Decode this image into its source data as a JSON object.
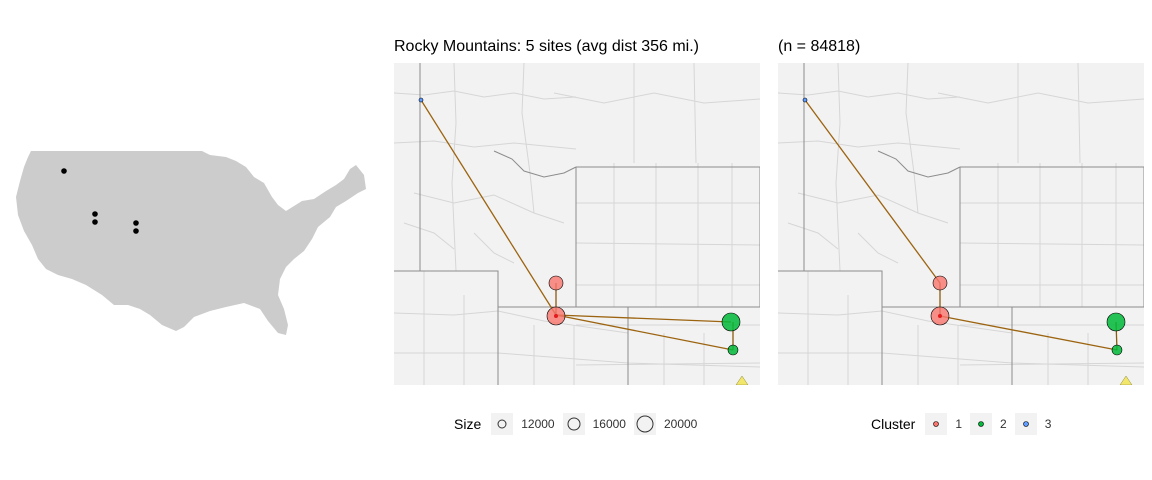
{
  "inset_map": {
    "colors": {
      "land": "#cccccc",
      "site_dot": "#000000"
    }
  },
  "left_panel": {
    "title": "Rocky Mountains: 5 sites (avg dist 356 mi.)"
  },
  "right_panel": {
    "title": "(n = 84818)"
  },
  "size_legend": {
    "title": "Size",
    "entries": [
      {
        "label": "12000"
      },
      {
        "label": "16000"
      },
      {
        "label": "20000"
      }
    ]
  },
  "cluster_legend": {
    "title": "Cluster",
    "entries": [
      {
        "label": "1",
        "color": "#f8766d"
      },
      {
        "label": "2",
        "color": "#00ba38"
      },
      {
        "label": "3",
        "color": "#619cff"
      }
    ]
  },
  "colors": {
    "panel_bg": "#f2f2f2",
    "county_lines": "#d6d6d6",
    "state_lines": "#8c8c8c",
    "route_line": "#9c6410",
    "marker_triangle": "#f2e66b"
  }
}
